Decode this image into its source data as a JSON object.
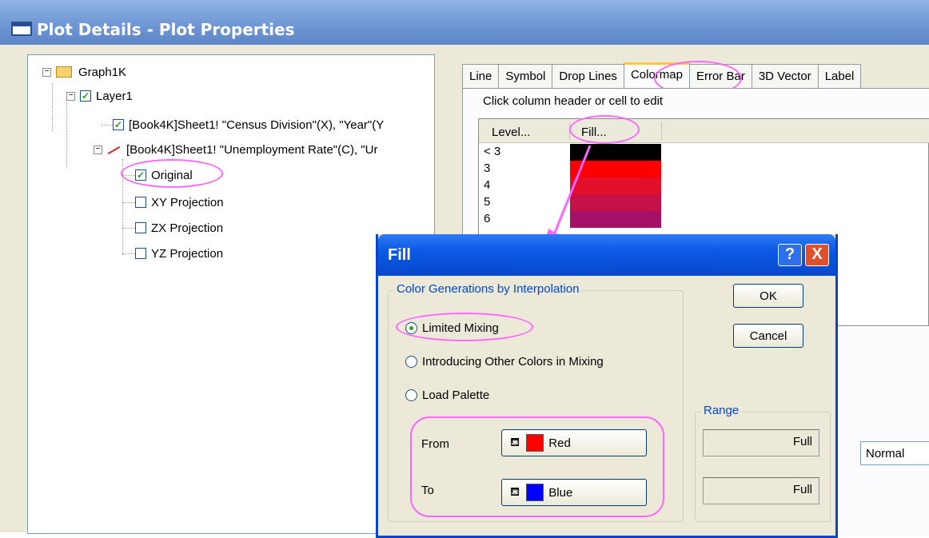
{
  "main_window": {
    "title": "Plot Details - Plot Properties"
  },
  "tree": {
    "items": [
      {
        "label": "Graph1K"
      },
      {
        "label": "Layer1"
      },
      {
        "label": "[Book4K]Sheet1! \"Census Division\"(X), \"Year\"(Y"
      },
      {
        "label": "[Book4K]Sheet1! \"Unemployment Rate\"(C), \"Ur"
      },
      {
        "label": "Original"
      },
      {
        "label": "XY Projection"
      },
      {
        "label": "ZX Projection"
      },
      {
        "label": "YZ Projection"
      }
    ]
  },
  "tabs": [
    "Line",
    "Symbol",
    "Drop Lines",
    "Colormap",
    "Error Bar",
    "3D Vector",
    "Label"
  ],
  "colormap": {
    "hint": "Click column header or cell to edit",
    "headers": {
      "level": "Level...",
      "fill": "Fill..."
    },
    "rows": [
      {
        "level": "< 3",
        "color": "#000000"
      },
      {
        "level": "3",
        "color": "#ff0000"
      },
      {
        "level": "4",
        "color": "#e30f2a"
      },
      {
        "level": "5",
        "color": "#c51048"
      },
      {
        "level": "6",
        "color": "#a51068"
      }
    ]
  },
  "normal_field": "Normal",
  "fill_dialog": {
    "title": "Fill",
    "help_label": "?",
    "close_label": "X",
    "group_title": "Color Generations by Interpolation",
    "options": [
      {
        "label": "Limited Mixing",
        "selected": true
      },
      {
        "label": "Introducing Other Colors in Mixing",
        "selected": false
      },
      {
        "label": "Load Palette",
        "selected": false
      }
    ],
    "from_label": "From",
    "to_label": "To",
    "from_color": {
      "name": "Red",
      "hex": "#ff0000"
    },
    "to_color": {
      "name": "Blue",
      "hex": "#0000ff"
    },
    "ok_label": "OK",
    "cancel_label": "Cancel",
    "range_title": "Range",
    "range_values": [
      "Full",
      "Full"
    ]
  },
  "colors": {
    "highlight": "#ff66ff",
    "xp_blue": "#0748cc"
  }
}
